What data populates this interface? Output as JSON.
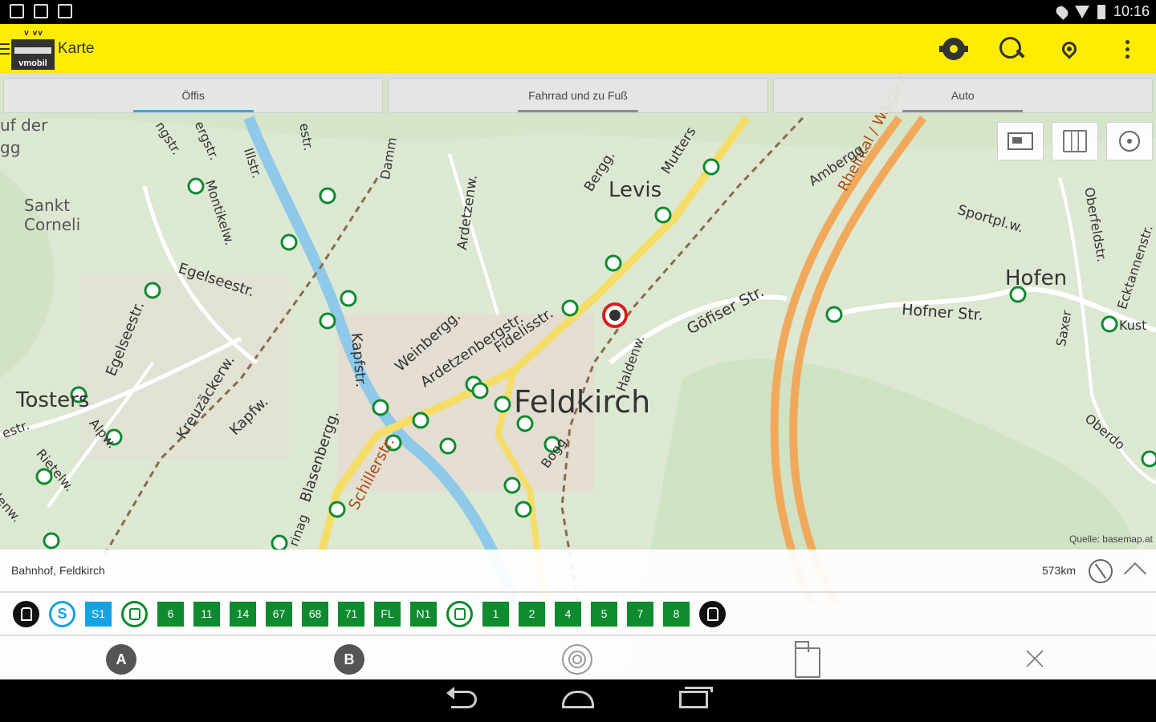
{
  "status_bar": {
    "time": "10:16"
  },
  "app_bar": {
    "title": "Karte",
    "logo_text": "vmobil",
    "logo_cars": [
      "v",
      "vv"
    ]
  },
  "tabs": [
    {
      "label": "Öffis",
      "active": true
    },
    {
      "label": "Fahrrad und zu Fuß",
      "active": false
    },
    {
      "label": "Auto",
      "active": false
    }
  ],
  "map": {
    "source": "Quelle: basemap.at",
    "labels": {
      "city": "Feldkirch",
      "levis": "Levis",
      "hofen": "Hofen",
      "tosters": "Tosters",
      "sankt_corneli": "Sankt\nCorneli",
      "auf_der": "uf der",
      "egg": "gg",
      "rheintal": "Rheintal / Walgau",
      "goefiser": "Göfiser Str.",
      "hofner": "Hofner Str.",
      "schiller": "Schillerstr.",
      "ardetzenberg": "Ardetzenbergstr.",
      "fidelis": "Fidelisstr.",
      "weinbergg": "Weinbergg.",
      "egelsee": "Egelseestr.",
      "egelseestr2": "Egelseestr.",
      "kreuzacker": "Kreuzäckerw.",
      "kapfw": "Kapfw.",
      "kapfstr": "Kapfstr.",
      "blasenberg": "Blasenbergg.",
      "ardetzenw": "Ardetzenw.",
      "bergg": "Bergg.",
      "mutters": "Mutters",
      "amberg": "Ambergg.",
      "sportpl": "Sportpl.w.",
      "oberfeld": "Oberfeldstr.",
      "ecktannen": "Ecktannenstr.",
      "saxer": "Saxer",
      "kust": "Kust",
      "oberdo": "Oberdo",
      "haldenw": "Haldenw.",
      "bogg": "Bogg.",
      "montikel": "Montikelw.",
      "illstr": "Illstr.",
      "damm": "Damm",
      "estr": "estr.",
      "ngstr": "ngstr.",
      "bergstr": "ergstr.",
      "alpw": "Alpw.",
      "rietelw": "Rietelw.",
      "lenw": "llenw.",
      "rinag": "rinag",
      "estr2": "estr."
    }
  },
  "stop_panel": {
    "name": "Bahnhof, Feldkirch",
    "distance": "573km",
    "lines": [
      {
        "kind": "mode",
        "type": "train"
      },
      {
        "kind": "mode",
        "type": "sbahn",
        "text": "S"
      },
      {
        "kind": "badge",
        "text": "S1",
        "color": "#16a2e0"
      },
      {
        "kind": "mode",
        "type": "bus"
      },
      {
        "kind": "badge",
        "text": "6"
      },
      {
        "kind": "badge",
        "text": "11"
      },
      {
        "kind": "badge",
        "text": "14"
      },
      {
        "kind": "badge",
        "text": "67"
      },
      {
        "kind": "badge",
        "text": "68"
      },
      {
        "kind": "badge",
        "text": "71"
      },
      {
        "kind": "badge",
        "text": "FL"
      },
      {
        "kind": "badge",
        "text": "N1"
      },
      {
        "kind": "mode",
        "type": "bus"
      },
      {
        "kind": "badge",
        "text": "1"
      },
      {
        "kind": "badge",
        "text": "2"
      },
      {
        "kind": "badge",
        "text": "4"
      },
      {
        "kind": "badge",
        "text": "5"
      },
      {
        "kind": "badge",
        "text": "7"
      },
      {
        "kind": "badge",
        "text": "8"
      },
      {
        "kind": "mode",
        "type": "train"
      }
    ],
    "toolbar": {
      "a_label": "A",
      "b_label": "B"
    }
  },
  "colors": {
    "appbar": "#ffec00",
    "bus_green": "#0e8a2f",
    "sbahn_blue": "#16a2e0",
    "accent_tab": "#39a8e0"
  }
}
